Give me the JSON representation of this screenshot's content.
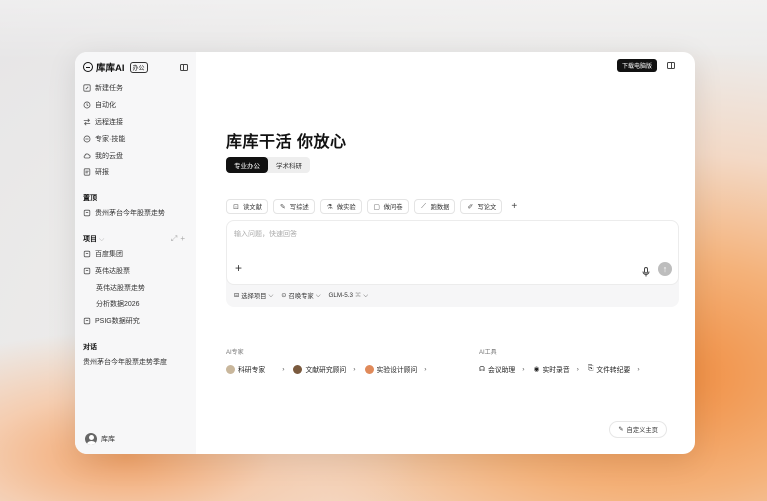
{
  "sidebar": {
    "logo_text": "库库AI",
    "logo_badge": "办公",
    "nav": [
      {
        "icon": "edit-icon",
        "label": "新建任务"
      },
      {
        "icon": "automation-icon",
        "label": "自动化"
      },
      {
        "icon": "connect-icon",
        "label": "远程连接"
      },
      {
        "icon": "expert-icon",
        "label": "专家·技能"
      },
      {
        "icon": "cloud-icon",
        "label": "我的云盘"
      },
      {
        "icon": "report-icon",
        "label": "研报"
      }
    ],
    "pinned": {
      "title": "置顶",
      "items": [
        "贵州茅台今年股票走势"
      ]
    },
    "projects": {
      "title": "项目",
      "items": [
        {
          "label": "百度集团",
          "children": []
        },
        {
          "label": "英伟达股票",
          "children": [
            "英伟达股票走势",
            "分析数据2026"
          ]
        },
        {
          "label": "PSIG数据研究",
          "children": []
        }
      ]
    },
    "conversations": {
      "title": "对话",
      "items": [
        "贵州茅台今年股票走势季度"
      ]
    },
    "user": {
      "name": "库库"
    }
  },
  "main": {
    "download_label": "下载电脑版",
    "headline": "库库干活 你放心",
    "mode_tabs": [
      "专业办公",
      "学术科研"
    ],
    "quick_actions": [
      "读文献",
      "写综述",
      "做实验",
      "做问卷",
      "跑数据",
      "写论文"
    ],
    "input": {
      "placeholder": "输入问题，快速回答"
    },
    "options": {
      "project": "选择项目",
      "expert": "召唤专家",
      "model": "GLM-5.3"
    },
    "ai_experts": {
      "title": "AI专家",
      "items": [
        "科研专家",
        "文献研究顾问",
        "实验设计顾问"
      ]
    },
    "ai_tools": {
      "title": "AI工具",
      "items": [
        "会议助理",
        "实时录音",
        "文件转纪要"
      ]
    },
    "custom_home_label": "自定义主页"
  },
  "colors": {
    "accent": "#111111",
    "send_disabled": "#bdbdbd",
    "sidebar_bg": "#f7f7f8"
  }
}
